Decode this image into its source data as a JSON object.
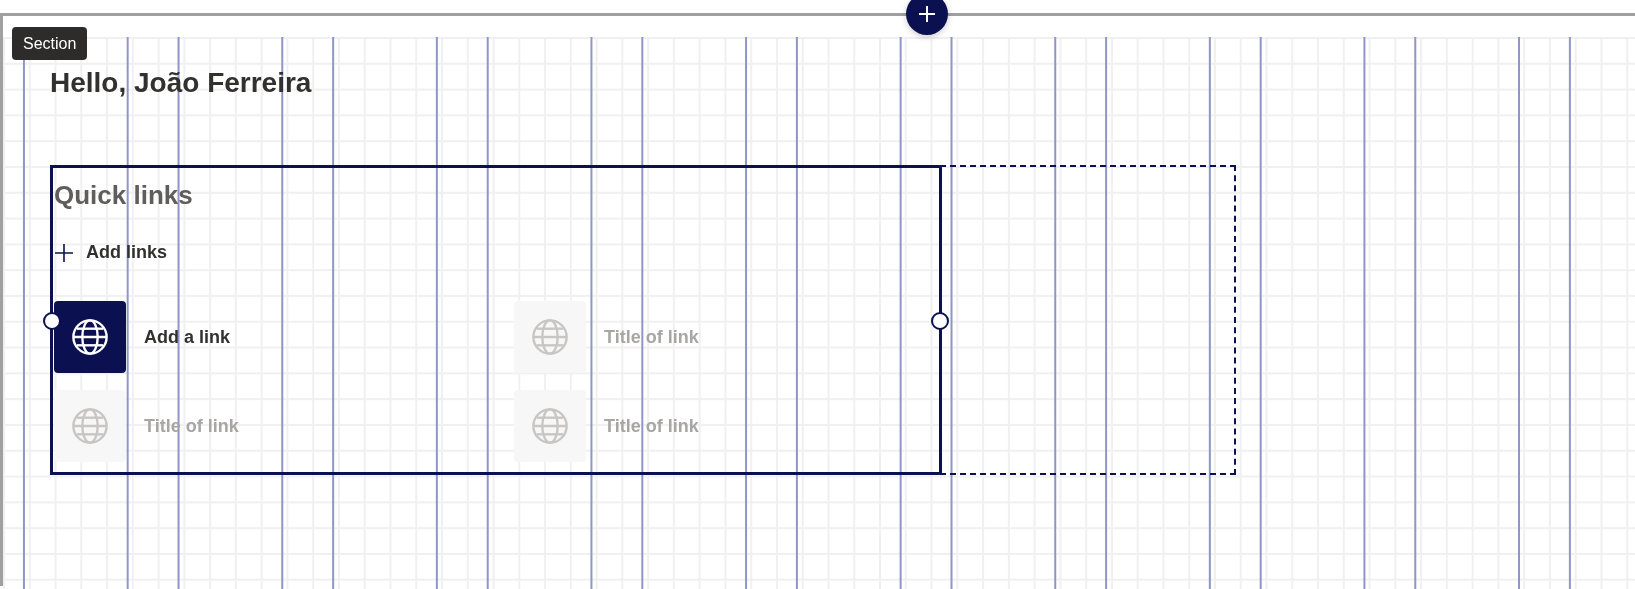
{
  "section_tag": "Section",
  "greeting": "Hello, João Ferreira",
  "quick_links": {
    "title": "Quick links",
    "add_links": "Add links",
    "links": [
      {
        "title": "Add a link",
        "kind": "active"
      },
      {
        "title": "Title of link",
        "kind": "placeholder"
      },
      {
        "title": "Title of link",
        "kind": "placeholder"
      },
      {
        "title": "Title of link",
        "kind": "placeholder"
      }
    ]
  }
}
